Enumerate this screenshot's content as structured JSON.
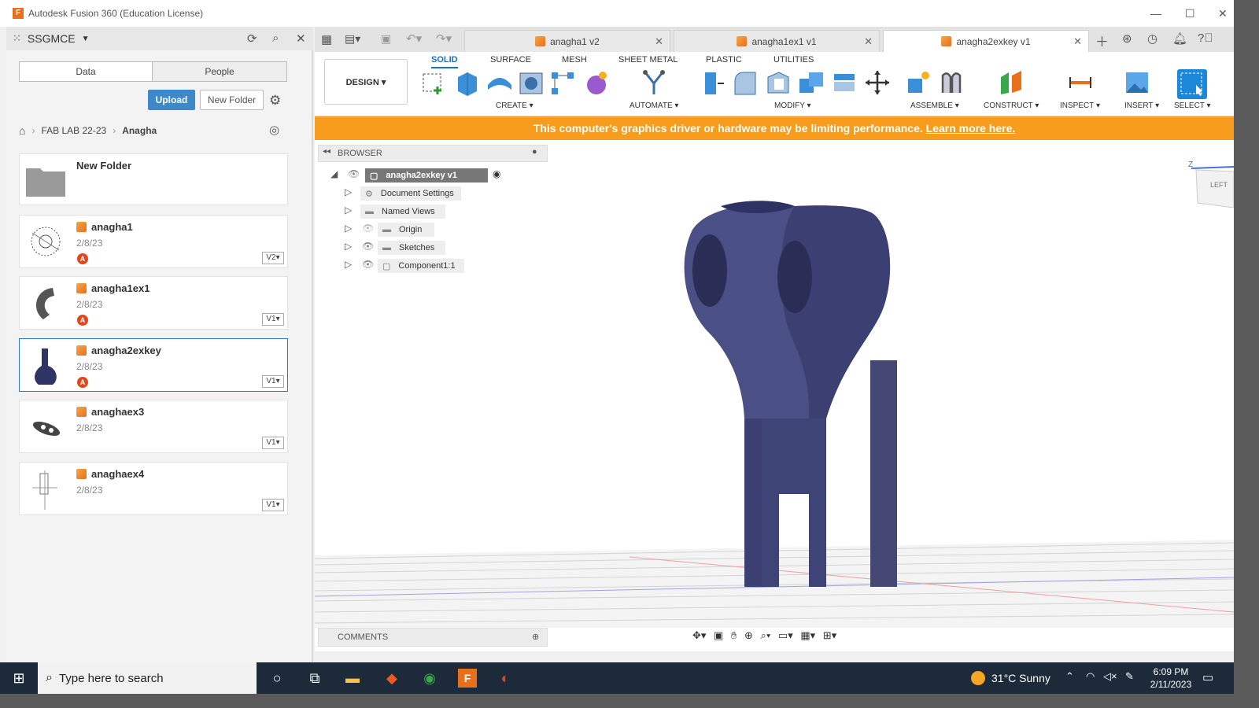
{
  "window": {
    "title": "Autodesk Fusion 360 (Education License)",
    "logo": "F"
  },
  "left_panel": {
    "team": "SSGMCE",
    "tabs": [
      "Data",
      "People"
    ],
    "upload_label": "Upload",
    "new_folder_label": "New Folder",
    "breadcrumb": [
      "FAB LAB 22-23",
      "Anagha"
    ],
    "items": [
      {
        "name": "New Folder",
        "date": "",
        "badge": "",
        "version": ""
      },
      {
        "name": "anagha1",
        "date": "2/8/23",
        "badge": "A",
        "version": "V2"
      },
      {
        "name": "anagha1ex1",
        "date": "2/8/23",
        "badge": "A",
        "version": "V1"
      },
      {
        "name": "anagha2exkey",
        "date": "2/8/23",
        "badge": "A",
        "version": "V1"
      },
      {
        "name": "anaghaex3",
        "date": "2/8/23",
        "badge": "",
        "version": "V1"
      },
      {
        "name": "anaghaex4",
        "date": "2/8/23",
        "badge": "",
        "version": "V1"
      }
    ]
  },
  "doc_tabs": [
    "anagha1 v2",
    "anagha1ex1 v1",
    "anagha2exkey v1"
  ],
  "workspace": "DESIGN",
  "ribbon_tabs": [
    "SOLID",
    "SURFACE",
    "MESH",
    "SHEET METAL",
    "PLASTIC",
    "UTILITIES"
  ],
  "ribbon_groups": [
    "CREATE",
    "AUTOMATE",
    "MODIFY",
    "ASSEMBLE",
    "CONSTRUCT",
    "INSPECT",
    "INSERT",
    "SELECT"
  ],
  "banner": {
    "text": "This computer's graphics driver or hardware may be limiting performance.",
    "link": "Learn more here."
  },
  "browser": {
    "title": "BROWSER",
    "root": "anagha2exkey v1",
    "nodes": [
      "Document Settings",
      "Named Views",
      "Origin",
      "Sketches",
      "Component1:1"
    ]
  },
  "comments_label": "COMMENTS",
  "viewcube_label": "LEFT",
  "viewcube_axis": "Z",
  "taskbar": {
    "search_placeholder": "Type here to search",
    "weather": "31°C  Sunny",
    "time": "6:09 PM",
    "date": "2/11/2023"
  },
  "colors": {
    "accent": "#1d6fb8",
    "banner": "#f89c1e",
    "model": "#3b3f72",
    "upload": "#3c88c9"
  }
}
